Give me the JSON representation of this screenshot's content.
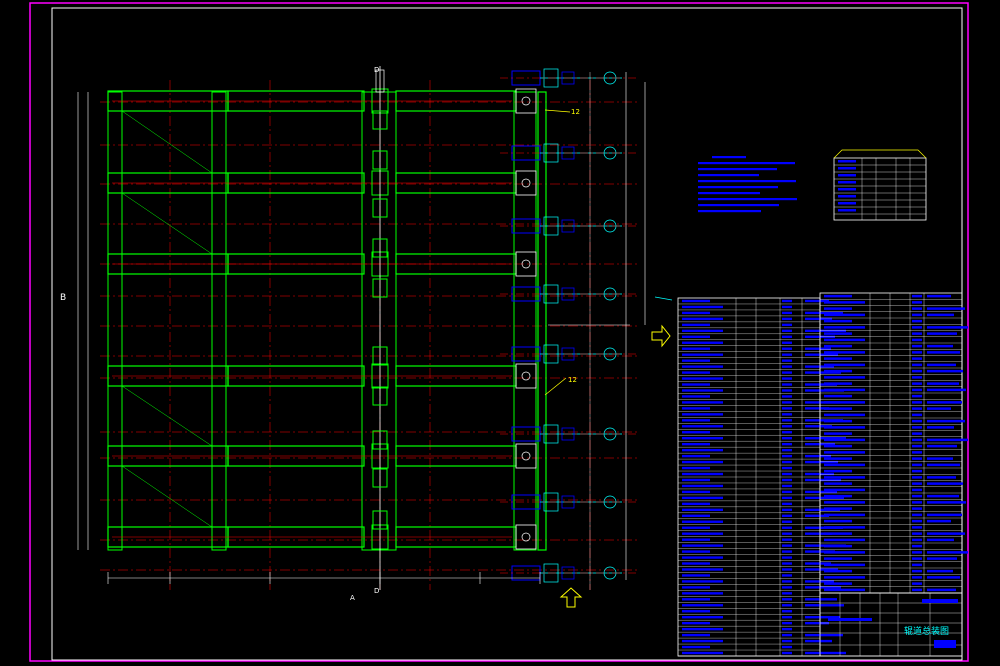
{
  "drawing": {
    "view_letters": {
      "section_top": "D",
      "section_bottom": "D",
      "view_b": "B",
      "view_a": "A"
    },
    "callouts": [
      "12",
      "12"
    ],
    "title_block": {
      "title": "辊道总装图"
    }
  },
  "colors": {
    "background": "#000000",
    "frame_border": "#ff00ff",
    "outline": "#ffffff",
    "structure": "#00ff00",
    "centerline": "#ff0000",
    "dimension": "#00ffff",
    "annotation": "#ffff00",
    "text": "#0000ff"
  }
}
